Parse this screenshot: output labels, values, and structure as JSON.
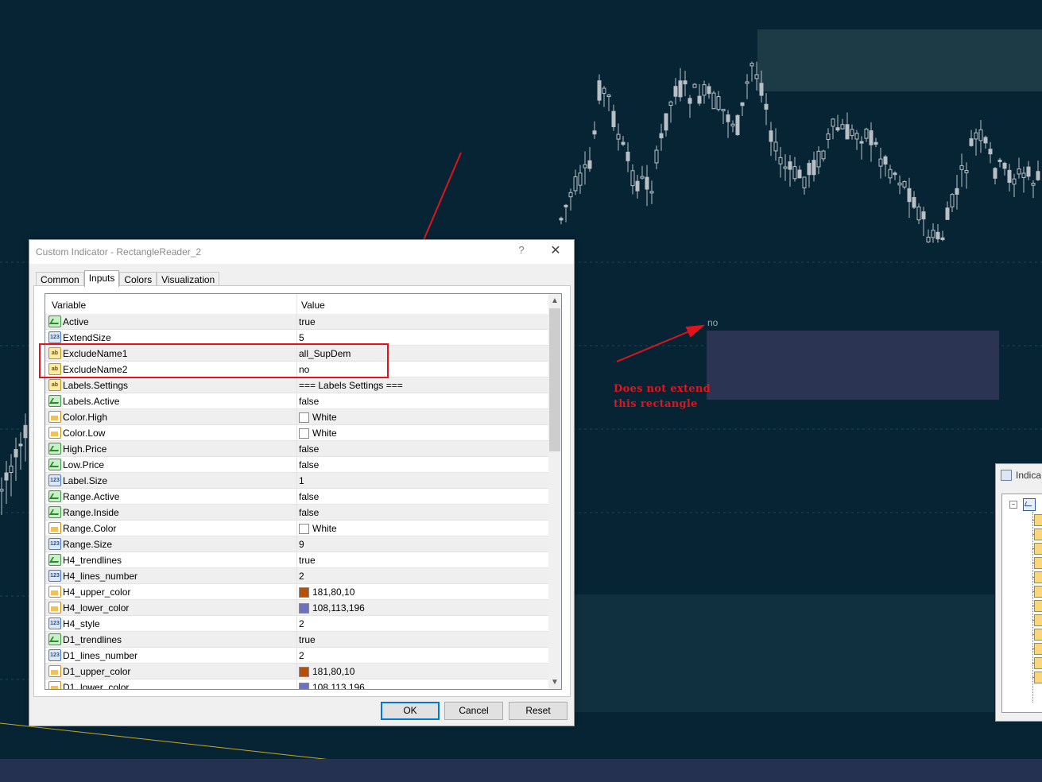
{
  "chart": {
    "annotation_label": "no",
    "annotation_note_line1": "Does not extend",
    "annotation_note_line2": "this rectangle"
  },
  "dialog": {
    "title": "Custom Indicator - RectangleReader_2",
    "help_label": "?",
    "close_label": "✕",
    "tabs": [
      {
        "label": "Common",
        "active": false
      },
      {
        "label": "Inputs",
        "active": true
      },
      {
        "label": "Colors",
        "active": false
      },
      {
        "label": "Visualization",
        "active": false
      }
    ],
    "grid": {
      "col_variable": "Variable",
      "col_value": "Value",
      "rows": [
        {
          "name": "Active",
          "type": "bool",
          "value": "true"
        },
        {
          "name": "ExtendSize",
          "type": "num",
          "value": "5"
        },
        {
          "name": "ExcludeName1",
          "type": "str",
          "value": "all_SupDem"
        },
        {
          "name": "ExcludeName2",
          "type": "str",
          "value": "no"
        },
        {
          "name": "Labels.Settings",
          "type": "str",
          "value": "=== Labels Settings ==="
        },
        {
          "name": "Labels.Active",
          "type": "bool",
          "value": "false"
        },
        {
          "name": "Color.High",
          "type": "color",
          "value": "White",
          "swatch": "#ffffff"
        },
        {
          "name": "Color.Low",
          "type": "color",
          "value": "White",
          "swatch": "#ffffff"
        },
        {
          "name": "High.Price",
          "type": "bool",
          "value": "false"
        },
        {
          "name": "Low.Price",
          "type": "bool",
          "value": "false"
        },
        {
          "name": "Label.Size",
          "type": "num",
          "value": "1"
        },
        {
          "name": "Range.Active",
          "type": "bool",
          "value": "false"
        },
        {
          "name": "Range.Inside",
          "type": "bool",
          "value": "false"
        },
        {
          "name": "Range.Color",
          "type": "color",
          "value": "White",
          "swatch": "#ffffff"
        },
        {
          "name": "Range.Size",
          "type": "num",
          "value": "9"
        },
        {
          "name": "H4_trendlines",
          "type": "bool",
          "value": "true"
        },
        {
          "name": "H4_lines_number",
          "type": "num",
          "value": "2"
        },
        {
          "name": "H4_upper_color",
          "type": "color",
          "value": "181,80,10",
          "swatch": "#b5500a"
        },
        {
          "name": "H4_lower_color",
          "type": "color",
          "value": "108,113,196",
          "swatch": "#6c71c4"
        },
        {
          "name": "H4_style",
          "type": "num",
          "value": "2"
        },
        {
          "name": "D1_trendlines",
          "type": "bool",
          "value": "true"
        },
        {
          "name": "D1_lines_number",
          "type": "num",
          "value": "2"
        },
        {
          "name": "D1_upper_color",
          "type": "color",
          "value": "181,80,10",
          "swatch": "#b5500a"
        },
        {
          "name": "D1_lower_color",
          "type": "color",
          "value": "108,113,196",
          "swatch": "#6c71c4"
        }
      ]
    },
    "buttons": {
      "ok": "OK",
      "cancel": "Cancel",
      "reset": "Reset"
    }
  },
  "side_window": {
    "title": "Indica"
  },
  "colors": {
    "chart_bg": "#062434",
    "candle": "#b8c0c6",
    "zone_upper": "#1d3a47",
    "zone_mid": "#2b3452",
    "zone_lower": "#10303f",
    "annotation_red": "#e0141c",
    "trendline": "#c8a82a"
  }
}
